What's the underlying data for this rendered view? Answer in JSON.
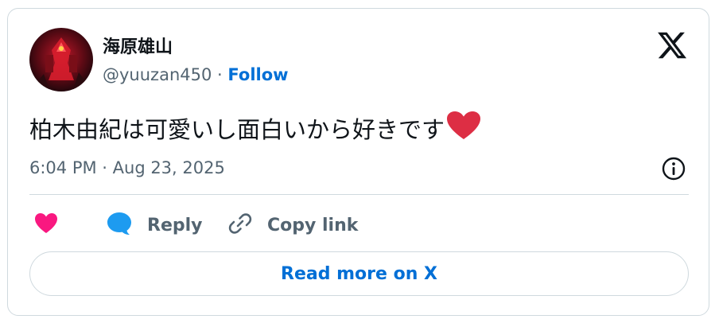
{
  "author": {
    "display_name": "海原雄山",
    "handle": "@yuuzan450",
    "separator": "·",
    "follow_label": "Follow"
  },
  "tweet": {
    "text": "柏木由紀は可愛いし面白いから好きです",
    "emoji": "red-heart-emoji",
    "timestamp": "6:04 PM · Aug 23, 2025"
  },
  "actions": {
    "like_icon": "heart-icon",
    "reply_label": "Reply",
    "copy_label": "Copy link"
  },
  "footer": {
    "read_more_label": "Read more on X"
  },
  "colors": {
    "accent": "#006fd6",
    "like": "#f91880",
    "reply_icon": "#1d9bf0",
    "muted": "#536471",
    "border": "#cfd9de"
  }
}
